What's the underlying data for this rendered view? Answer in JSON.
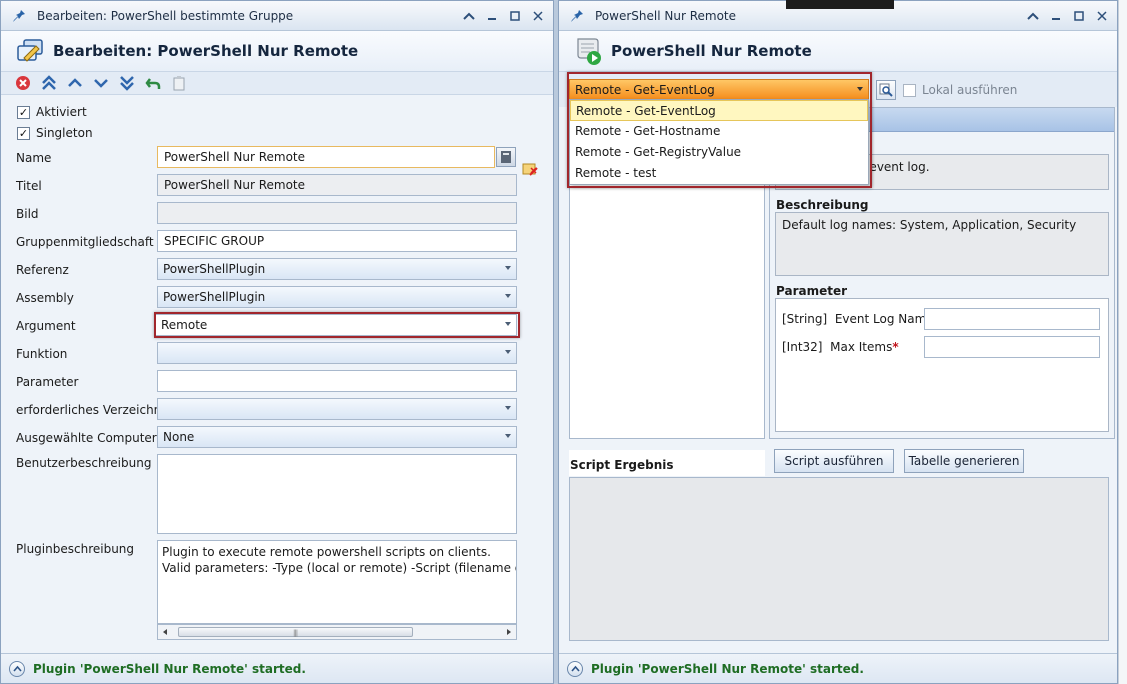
{
  "left_window": {
    "title": "Bearbeiten: PowerShell bestimmte Gruppe",
    "heading": "Bearbeiten: PowerShell Nur Remote",
    "checkboxes": [
      {
        "label": "Aktiviert",
        "checked": true
      },
      {
        "label": "Singleton",
        "checked": true
      }
    ],
    "fields": {
      "name": {
        "label": "Name",
        "value": "PowerShell Nur Remote"
      },
      "titel": {
        "label": "Titel",
        "value": "PowerShell Nur Remote"
      },
      "bild": {
        "label": "Bild",
        "value": ""
      },
      "gruppen": {
        "label": "Gruppenmitgliedschaft",
        "value": "SPECIFIC GROUP"
      },
      "referenz": {
        "label": "Referenz",
        "value": "PowerShellPlugin"
      },
      "assembly": {
        "label": "Assembly",
        "value": "PowerShellPlugin"
      },
      "argument": {
        "label": "Argument",
        "value": "Remote"
      },
      "funktion": {
        "label": "Funktion",
        "value": ""
      },
      "parameter": {
        "label": "Parameter",
        "value": ""
      },
      "verzeichnis": {
        "label": "erforderliches Verzeichnis",
        "value": ""
      },
      "computer": {
        "label": "Ausgewählte Computer",
        "value": "None"
      },
      "benutzer": {
        "label": "Benutzerbeschreibung",
        "value": ""
      },
      "plugin": {
        "label": "Pluginbeschreibung",
        "line1": "Plugin to execute remote powershell scripts on clients.",
        "line2": "Valid parameters: -Type (local or remote) -Script (filename of the scr"
      }
    },
    "status": "Plugin 'PowerShell Nur Remote' started."
  },
  "right_window": {
    "title": "PowerShell Nur Remote",
    "heading": "PowerShell Nur Remote",
    "selected_script": "Remote - Get-EventLog",
    "dropdown_items": [
      "Remote - Get-EventLog",
      "Remote - Get-Hostname",
      "Remote - Get-RegistryValue",
      "Remote - test"
    ],
    "lokal_label": "Lokal ausführen",
    "partial_title": "g",
    "partial_text": "d event log.",
    "beschreibung_title": "Beschreibung",
    "beschreibung_text": "Default log names: System, Application, Security",
    "parameter_title": "Parameter",
    "params": [
      {
        "type": "[String]",
        "name": "Event Log Name",
        "req": "*"
      },
      {
        "type": "[Int32]",
        "name": "Max Items",
        "req": "*"
      }
    ],
    "script_result_label": "Script Ergebnis",
    "btn_run": "Script ausführen",
    "btn_table": "Tabelle generieren",
    "status": "Plugin 'PowerShell Nur Remote' started."
  },
  "colors": {
    "accent_orange": "#f48a19",
    "highlight_red": "#a1262c",
    "status_green": "#1f6d24"
  }
}
